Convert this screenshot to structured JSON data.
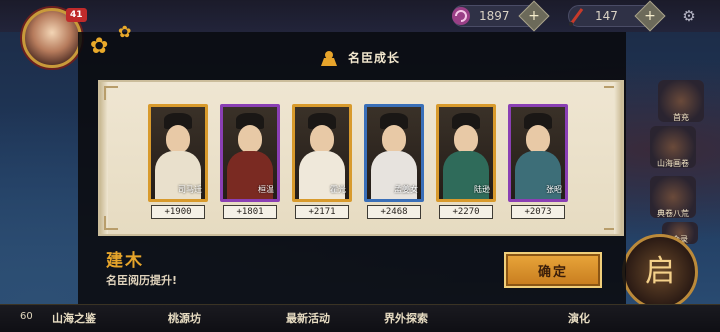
{
  "header": {
    "level_badge": "41",
    "currency_a": {
      "icon": "swirl-gem-icon",
      "value": "1897"
    },
    "currency_b": {
      "icon": "brush-icon",
      "value": "147"
    }
  },
  "right_menu": [
    {
      "label": "首充"
    },
    {
      "label": "山海画卷"
    },
    {
      "label": "典卷八荒"
    },
    {
      "label": "合录"
    }
  ],
  "modal": {
    "title": "名臣成长",
    "heroes": [
      {
        "name": "司马迁",
        "gain": "+1900",
        "frame_color": "#d89a2c",
        "robe_color": "#e9e0cc"
      },
      {
        "name": "桓温",
        "gain": "+1801",
        "frame_color": "#8a3fb4",
        "robe_color": "#7a2a22"
      },
      {
        "name": "霍光",
        "gain": "+2171",
        "frame_color": "#d89a2c",
        "robe_color": "#efe8da"
      },
      {
        "name": "孟姜女",
        "gain": "+2468",
        "frame_color": "#3a6fb8",
        "robe_color": "#e7e3de"
      },
      {
        "name": "陆逊",
        "gain": "+2270",
        "frame_color": "#d89a2c",
        "robe_color": "#2f6b5a"
      },
      {
        "name": "张昭",
        "gain": "+2073",
        "frame_color": "#8a3fb4",
        "robe_color": "#3d6e78"
      }
    ],
    "char_name": "建木",
    "char_desc": "名臣阅历提升!",
    "confirm_label": "确定"
  },
  "bottom_nav": {
    "count": "60",
    "items": [
      "山海之鉴",
      "桃源坊",
      "最新活动",
      "界外探索",
      "演化"
    ]
  },
  "corner_button_glyph": "启",
  "colors": {
    "accent": "#e6a52b",
    "panel": "#e6dbc1",
    "purple_frame": "#8a3fb4",
    "gold_frame": "#d89a2c",
    "blue_frame": "#3a6fb8"
  }
}
